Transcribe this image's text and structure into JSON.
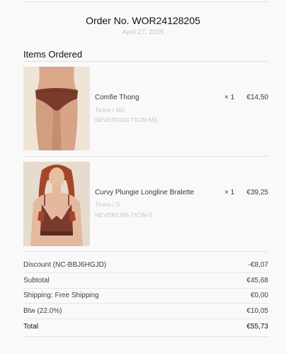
{
  "order": {
    "title": "Order No. WOR24128205",
    "date": "April 27, 2025"
  },
  "section": {
    "title": "Items Ordered"
  },
  "items": [
    {
      "name": "Comfie Thong",
      "variant": "Ticino / M/L",
      "sku": "NEVER0343-TICIN-M/L",
      "qty": "× 1",
      "price": "€14,50",
      "image_icon": "thong-product-photo"
    },
    {
      "name": "Curvy Plungie Longline Bralette",
      "variant": "Ticino / S",
      "sku": "NEVER1385-TICIN-S",
      "qty": "× 1",
      "price": "€39,25",
      "image_icon": "bralette-product-photo"
    }
  ],
  "summary": [
    {
      "label": "Discount (NC-BBJ6HGJD)",
      "value": "-€8,07"
    },
    {
      "label": "Subtotal",
      "value": "€45,68"
    },
    {
      "label": "Shipping: Free Shipping",
      "value": "€0,00"
    },
    {
      "label": "Btw (22.0%)",
      "value": "€10,05"
    },
    {
      "label": "Total",
      "value": "€55,73"
    }
  ],
  "colors": {
    "background": "#f9f9f9",
    "product_color": "#7a3a2c",
    "muted_text": "#c4c4c4"
  }
}
